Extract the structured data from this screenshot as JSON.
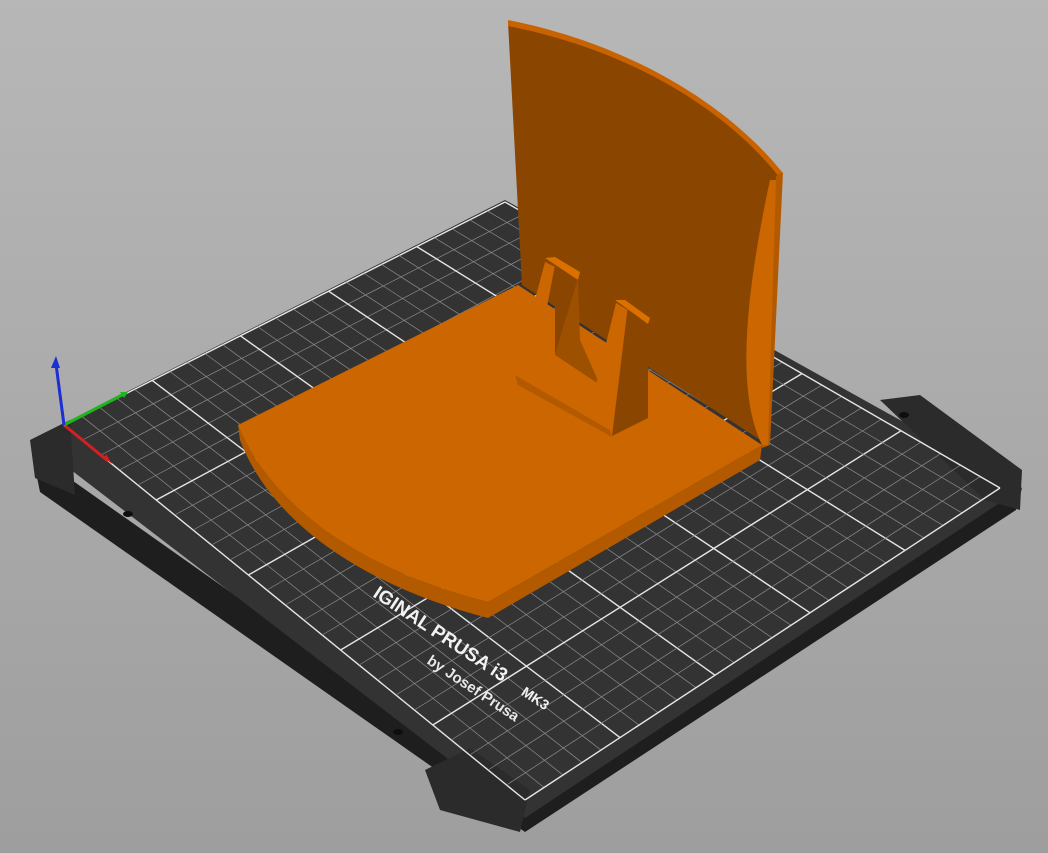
{
  "app": {
    "view": "3D plater viewport"
  },
  "bed": {
    "brand_line": "IGINAL PRUSA i3",
    "model_suffix": "MK3",
    "byline": "by Josef Prusa",
    "sheet_color": "#333333",
    "grid_color": "#8c8c8c",
    "grid_major_color": "#e6e6e6"
  },
  "model": {
    "color_face": "#cc6600",
    "color_shadow": "#8a4600",
    "color_edge": "#b35a00"
  },
  "axes": {
    "x_color": "#d42020",
    "y_color": "#1fb51f",
    "z_color": "#1a2fd4",
    "x_icon": "x-axis-arrow-icon",
    "y_icon": "y-axis-arrow-icon",
    "z_icon": "z-axis-arrow-icon"
  }
}
